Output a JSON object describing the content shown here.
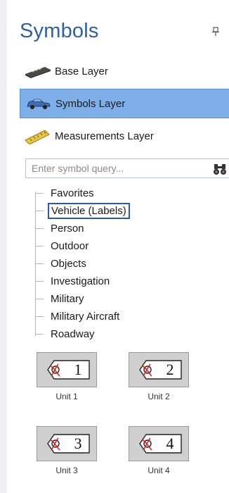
{
  "panel": {
    "title": "Symbols",
    "pin_icon": "pin-icon"
  },
  "layers": [
    {
      "label": "Base Layer",
      "icon": "base-layer-icon",
      "active": false
    },
    {
      "label": "Symbols Layer",
      "icon": "car-icon",
      "active": true
    },
    {
      "label": "Measurements Layer",
      "icon": "ruler-icon",
      "active": false
    }
  ],
  "search": {
    "placeholder": "Enter symbol query...",
    "value": "",
    "icon": "binoculars-icon"
  },
  "tree": [
    {
      "label": "Favorites",
      "selected": false
    },
    {
      "label": "Vehicle (Labels)",
      "selected": true
    },
    {
      "label": "Person",
      "selected": false
    },
    {
      "label": "Outdoor",
      "selected": false
    },
    {
      "label": "Objects",
      "selected": false
    },
    {
      "label": "Investigation",
      "selected": false
    },
    {
      "label": "Military",
      "selected": false
    },
    {
      "label": "Military Aircraft",
      "selected": false
    },
    {
      "label": "Roadway",
      "selected": false
    }
  ],
  "symbols": [
    {
      "number": "1",
      "caption": "Unit 1"
    },
    {
      "number": "2",
      "caption": "Unit 2"
    },
    {
      "number": "3",
      "caption": "Unit 3"
    },
    {
      "number": "4",
      "caption": "Unit 4"
    }
  ],
  "colors": {
    "title": "#2e5fa8",
    "active_layer_bg": "#7eaee8",
    "selection_border": "#2c5ba6"
  }
}
